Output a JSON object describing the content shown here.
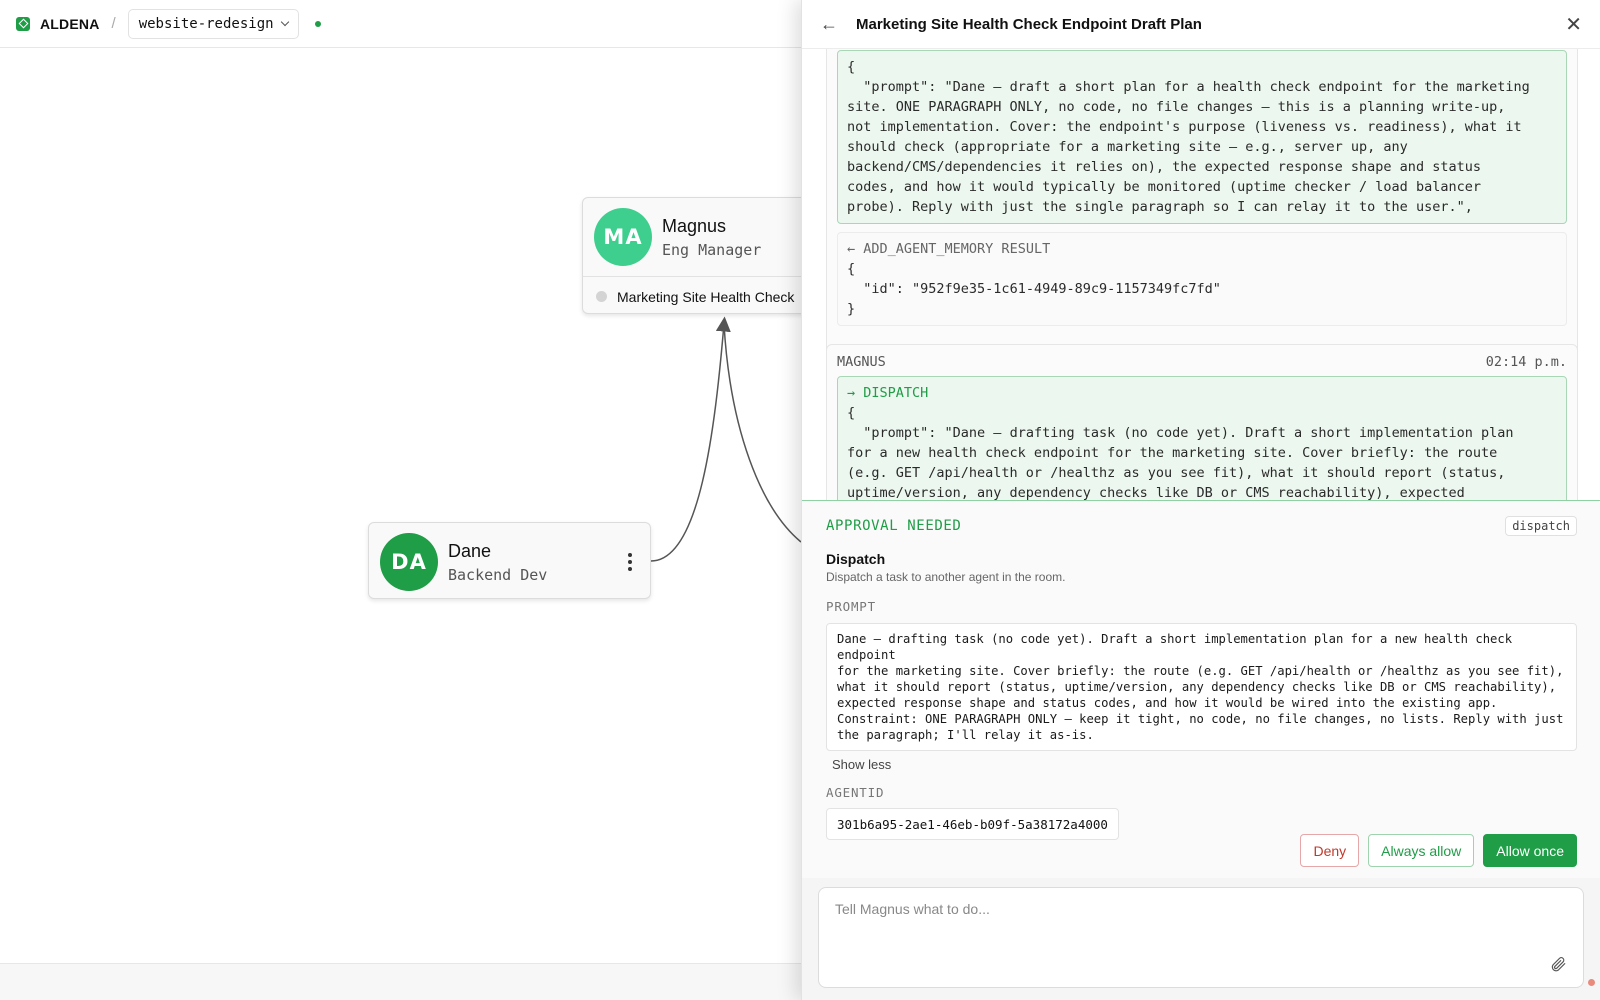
{
  "topbar": {
    "brand": "ALDENA",
    "separator": "/",
    "project": "website-redesign"
  },
  "canvas": {
    "nodes": [
      {
        "initials": "MA",
        "name": "Magnus",
        "role": "Eng Manager",
        "task": "Marketing Site Health Check",
        "color": "#3ecf8e"
      },
      {
        "initials": "DA",
        "name": "Dane",
        "role": "Backend Dev",
        "color": "#1f9d47"
      }
    ]
  },
  "drawer": {
    "title": "Marketing Site Health Check Endpoint Draft Plan",
    "messages": [
      {
        "body": "{\n  \"prompt\": \"Dane — draft a short plan for a health check endpoint for the marketing\nsite. ONE PARAGRAPH ONLY, no code, no file changes — this is a planning write-up,\nnot implementation. Cover: the endpoint's purpose (liveness vs. readiness), what it\nshould check (appropriate for a marketing site — e.g., server up, any\nbackend/CMS/dependencies it relies on), the expected response shape and status\ncodes, and how it would typically be monitored (uptime checker / load balancer\nprobe). Reply with just the single paragraph so I can relay it to the user.\",",
        "result_label": "ADD_AGENT_MEMORY RESULT",
        "result_body": "{\n  \"id\": \"952f9e35-1c61-4949-89c9-1157349fc7fd\"\n}"
      },
      {
        "sender": "MAGNUS",
        "time": "02:14 p.m.",
        "action_label": "DISPATCH",
        "body": "{\n  \"prompt\": \"Dane — drafting task (no code yet). Draft a short implementation plan\nfor a new health check endpoint for the marketing site. Cover briefly: the route\n(e.g. GET /api/health or /healthz as you see fit), what it should report (status,\nuptime/version, any dependency checks like DB or CMS reachability), expected"
      }
    ]
  },
  "approval": {
    "heading": "APPROVAL NEEDED",
    "tag": "dispatch",
    "title": "Dispatch",
    "description": "Dispatch a task to another agent in the room.",
    "prompt_label": "PROMPT",
    "prompt_text": "Dane — drafting task (no code yet). Draft a short implementation plan for a new health check endpoint\nfor the marketing site. Cover briefly: the route (e.g. GET /api/health or /healthz as you see fit),\nwhat it should report (status, uptime/version, any dependency checks like DB or CMS reachability),\nexpected response shape and status codes, and how it would be wired into the existing app.\nConstraint: ONE PARAGRAPH ONLY — keep it tight, no code, no file changes, no lists. Reply with just\nthe paragraph; I'll relay it as-is.",
    "show_less": "Show less",
    "agentid_label": "AGENTID",
    "agentid": "301b6a95-2ae1-46eb-b09f-5a38172a4000",
    "buttons": {
      "deny": "Deny",
      "always": "Always allow",
      "once": "Allow once"
    }
  },
  "composer": {
    "placeholder": "Tell Magnus what to do..."
  },
  "colors": {
    "accent": "#1f9d47",
    "danger": "#c0392b"
  }
}
